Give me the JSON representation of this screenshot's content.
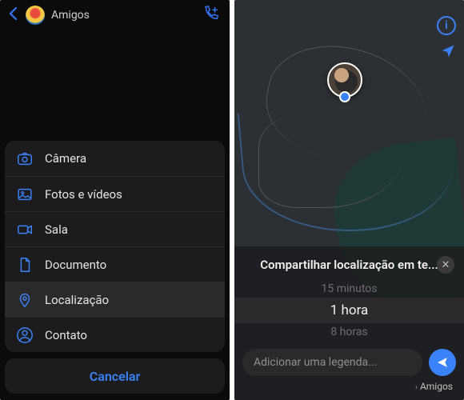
{
  "left": {
    "chat_title": "Amigos",
    "menu": [
      {
        "label": "Câmera",
        "icon": "camera-icon"
      },
      {
        "label": "Fotos e vídeos",
        "icon": "gallery-icon"
      },
      {
        "label": "Sala",
        "icon": "video-room-icon"
      },
      {
        "label": "Documento",
        "icon": "document-icon"
      },
      {
        "label": "Localização",
        "icon": "location-pin-icon"
      },
      {
        "label": "Contato",
        "icon": "contact-icon"
      }
    ],
    "cancel_label": "Cancelar"
  },
  "right": {
    "share_title": "Compartilhar localização em te...",
    "durations": {
      "short": "15 minutos",
      "medium": "1 hora",
      "long": "8 horas"
    },
    "caption_placeholder": "Adicionar uma legenda...",
    "recipient": "Amigos"
  },
  "colors": {
    "accent": "#3a82f7",
    "sheet_bg": "#1c1c1e"
  }
}
